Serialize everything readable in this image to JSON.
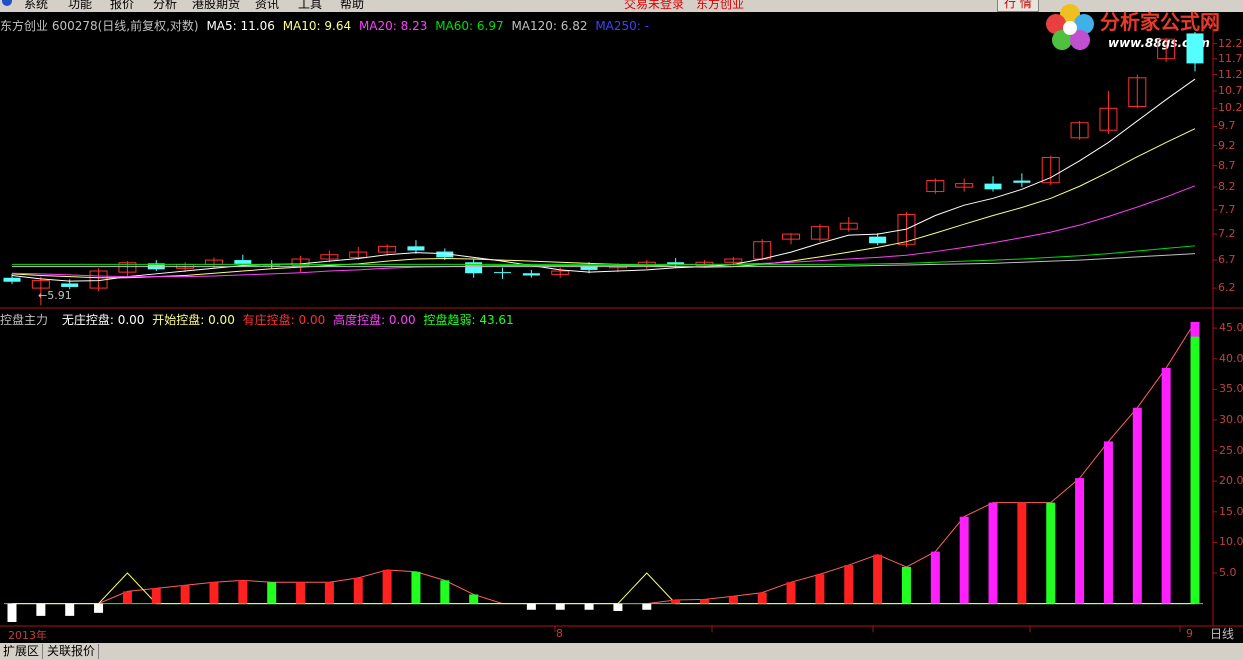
{
  "menu": {
    "items": [
      "系统",
      "功能",
      "报价",
      "分析",
      "港股期货",
      "资讯",
      "工具",
      "帮助"
    ],
    "login_status": "交易未登录",
    "stock_short": "东方创业",
    "hq_button": "行 情"
  },
  "watermark": {
    "text": "分析家公式网",
    "url": "www.88gs.com"
  },
  "stock_title": {
    "name": "东方创业 600278(日线,前复权,对数)",
    "ma5": "MA5: 11.06",
    "ma10": "MA10: 9.64",
    "ma20": "MA20: 8.23",
    "ma60": "MA60: 6.97",
    "ma120": "MA120: 6.82",
    "ma250": "MA250: -"
  },
  "low_marker": "←5.91",
  "indicator_title": {
    "name": "控盘主力",
    "f1": "无庄控盘: 0.00",
    "f2": "开始控盘: 0.00",
    "f3": "有庄控盘: 0.00",
    "f4": "高度控盘: 0.00",
    "f5": "控盘趋弱: 43.61"
  },
  "x_axis": {
    "labels": [
      "2013年",
      "8",
      "9"
    ]
  },
  "day_tab": "日线",
  "bottom_tabs": [
    "扩展区",
    "关联报价"
  ],
  "colors": {
    "up": "#ff3232",
    "down": "#54ffff",
    "ma5": "#ffffff",
    "ma10": "#ffff80",
    "ma20": "#ff40ff",
    "ma60": "#00e000",
    "ma120": "#c0c0c0",
    "ma250": "#4040ff",
    "axis": "#b01010",
    "ind_red": "#ff2020",
    "ind_magenta": "#ff20ff",
    "ind_green": "#20ff20",
    "ind_white": "#ffffff",
    "ind_yellow": "#ffff60"
  },
  "chart_data": [
    {
      "type": "candlestick",
      "title": "东方创业 600278(日线,前复权,对数)",
      "log_scale": true,
      "ylim": [
        5.9,
        12.6
      ],
      "y_ticks": [
        6.2,
        6.7,
        7.2,
        7.7,
        8.2,
        8.7,
        9.2,
        9.7,
        10.2,
        10.7,
        11.2,
        11.7,
        12.2
      ],
      "x_labels": [
        "2013年",
        "8",
        "9"
      ],
      "candles": [
        {
          "o": 6.38,
          "h": 6.45,
          "l": 6.27,
          "c": 6.31
        },
        {
          "o": 6.2,
          "h": 6.4,
          "l": 5.91,
          "c": 6.33
        },
        {
          "o": 6.28,
          "h": 6.35,
          "l": 6.18,
          "c": 6.22
        },
        {
          "o": 6.2,
          "h": 6.55,
          "l": 6.15,
          "c": 6.5
        },
        {
          "o": 6.48,
          "h": 6.68,
          "l": 6.4,
          "c": 6.65
        },
        {
          "o": 6.64,
          "h": 6.7,
          "l": 6.5,
          "c": 6.53
        },
        {
          "o": 6.55,
          "h": 6.66,
          "l": 6.48,
          "c": 6.62
        },
        {
          "o": 6.62,
          "h": 6.75,
          "l": 6.55,
          "c": 6.7
        },
        {
          "o": 6.7,
          "h": 6.8,
          "l": 6.58,
          "c": 6.63
        },
        {
          "o": 6.63,
          "h": 6.7,
          "l": 6.55,
          "c": 6.6
        },
        {
          "o": 6.6,
          "h": 6.78,
          "l": 6.48,
          "c": 6.72
        },
        {
          "o": 6.72,
          "h": 6.88,
          "l": 6.66,
          "c": 6.8
        },
        {
          "o": 6.75,
          "h": 6.95,
          "l": 6.7,
          "c": 6.85
        },
        {
          "o": 6.85,
          "h": 7.0,
          "l": 6.78,
          "c": 6.96
        },
        {
          "o": 6.96,
          "h": 7.08,
          "l": 6.82,
          "c": 6.88
        },
        {
          "o": 6.86,
          "h": 6.92,
          "l": 6.7,
          "c": 6.75
        },
        {
          "o": 6.66,
          "h": 6.72,
          "l": 6.38,
          "c": 6.46
        },
        {
          "o": 6.48,
          "h": 6.56,
          "l": 6.36,
          "c": 6.47
        },
        {
          "o": 6.46,
          "h": 6.52,
          "l": 6.38,
          "c": 6.42
        },
        {
          "o": 6.44,
          "h": 6.56,
          "l": 6.38,
          "c": 6.5
        },
        {
          "o": 6.6,
          "h": 6.66,
          "l": 6.46,
          "c": 6.52
        },
        {
          "o": 6.56,
          "h": 6.64,
          "l": 6.48,
          "c": 6.6
        },
        {
          "o": 6.6,
          "h": 6.7,
          "l": 6.54,
          "c": 6.66
        },
        {
          "o": 6.66,
          "h": 6.74,
          "l": 6.56,
          "c": 6.62
        },
        {
          "o": 6.6,
          "h": 6.7,
          "l": 6.56,
          "c": 6.66
        },
        {
          "o": 6.66,
          "h": 6.76,
          "l": 6.6,
          "c": 6.72
        },
        {
          "o": 6.72,
          "h": 7.1,
          "l": 6.7,
          "c": 7.05
        },
        {
          "o": 7.1,
          "h": 7.22,
          "l": 7.0,
          "c": 7.2
        },
        {
          "o": 7.1,
          "h": 7.4,
          "l": 7.05,
          "c": 7.35
        },
        {
          "o": 7.3,
          "h": 7.55,
          "l": 7.25,
          "c": 7.42
        },
        {
          "o": 7.15,
          "h": 7.22,
          "l": 6.98,
          "c": 7.02
        },
        {
          "o": 7.0,
          "h": 7.65,
          "l": 6.95,
          "c": 7.6
        },
        {
          "o": 8.1,
          "h": 8.4,
          "l": 8.05,
          "c": 8.35
        },
        {
          "o": 8.2,
          "h": 8.4,
          "l": 8.1,
          "c": 8.28
        },
        {
          "o": 8.28,
          "h": 8.45,
          "l": 8.1,
          "c": 8.15
        },
        {
          "o": 8.35,
          "h": 8.52,
          "l": 8.2,
          "c": 8.3
        },
        {
          "o": 8.3,
          "h": 8.95,
          "l": 8.25,
          "c": 8.9
        },
        {
          "o": 9.4,
          "h": 9.85,
          "l": 9.35,
          "c": 9.8
        },
        {
          "o": 9.6,
          "h": 10.7,
          "l": 9.5,
          "c": 10.2
        },
        {
          "o": 10.25,
          "h": 11.2,
          "l": 10.2,
          "c": 11.1
        },
        {
          "o": 11.7,
          "h": 12.4,
          "l": 11.6,
          "c": 12.35
        },
        {
          "o": 12.55,
          "h": 12.6,
          "l": 11.3,
          "c": 11.55
        }
      ],
      "series": [
        {
          "name": "MA5",
          "values": [
            6.42,
            6.36,
            6.32,
            6.33,
            6.4,
            6.45,
            6.5,
            6.55,
            6.6,
            6.62,
            6.63,
            6.68,
            6.73,
            6.8,
            6.84,
            6.82,
            6.75,
            6.68,
            6.6,
            6.52,
            6.48,
            6.5,
            6.52,
            6.56,
            6.58,
            6.62,
            6.72,
            6.85,
            7.02,
            7.18,
            7.2,
            7.3,
            7.58,
            7.8,
            7.95,
            8.15,
            8.42,
            8.82,
            9.28,
            9.85,
            10.45,
            11.06
          ]
        },
        {
          "name": "MA10",
          "values": [
            6.45,
            6.42,
            6.4,
            6.38,
            6.38,
            6.4,
            6.42,
            6.46,
            6.5,
            6.54,
            6.57,
            6.6,
            6.63,
            6.68,
            6.72,
            6.73,
            6.72,
            6.7,
            6.68,
            6.66,
            6.64,
            6.62,
            6.6,
            6.58,
            6.57,
            6.58,
            6.62,
            6.68,
            6.76,
            6.85,
            6.94,
            7.05,
            7.22,
            7.4,
            7.58,
            7.75,
            7.95,
            8.22,
            8.55,
            8.92,
            9.28,
            9.64
          ]
        },
        {
          "name": "MA20",
          "values": [
            6.46,
            6.45,
            6.43,
            6.41,
            6.4,
            6.4,
            6.4,
            6.41,
            6.43,
            6.45,
            6.47,
            6.5,
            6.52,
            6.55,
            6.57,
            6.58,
            6.59,
            6.6,
            6.6,
            6.6,
            6.6,
            6.6,
            6.6,
            6.61,
            6.62,
            6.62,
            6.64,
            6.66,
            6.69,
            6.72,
            6.75,
            6.79,
            6.86,
            6.94,
            7.03,
            7.13,
            7.24,
            7.38,
            7.56,
            7.76,
            7.98,
            8.23
          ]
        },
        {
          "name": "MA60",
          "values": [
            6.62,
            6.62,
            6.62,
            6.62,
            6.62,
            6.62,
            6.62,
            6.62,
            6.62,
            6.62,
            6.62,
            6.62,
            6.62,
            6.62,
            6.62,
            6.62,
            6.62,
            6.62,
            6.62,
            6.62,
            6.62,
            6.62,
            6.62,
            6.62,
            6.62,
            6.62,
            6.62,
            6.62,
            6.62,
            6.62,
            6.63,
            6.64,
            6.66,
            6.68,
            6.7,
            6.72,
            6.75,
            6.78,
            6.82,
            6.87,
            6.92,
            6.97
          ]
        },
        {
          "name": "MA120",
          "values": [
            6.58,
            6.58,
            6.58,
            6.58,
            6.58,
            6.58,
            6.58,
            6.58,
            6.58,
            6.58,
            6.58,
            6.58,
            6.58,
            6.58,
            6.58,
            6.58,
            6.58,
            6.58,
            6.58,
            6.58,
            6.58,
            6.58,
            6.58,
            6.58,
            6.58,
            6.58,
            6.58,
            6.58,
            6.58,
            6.59,
            6.6,
            6.61,
            6.62,
            6.63,
            6.64,
            6.66,
            6.68,
            6.7,
            6.73,
            6.76,
            6.79,
            6.82
          ]
        }
      ]
    },
    {
      "type": "bar",
      "title": "控盘主力",
      "ylim": [
        -3,
        46
      ],
      "y_ticks": [
        5,
        10,
        15,
        20,
        25,
        30,
        35,
        40,
        45
      ],
      "series": [
        {
          "name": "无庄控盘",
          "values": [
            -3,
            -2,
            -2,
            -1.5,
            0,
            0,
            0,
            0,
            0,
            0,
            0,
            0,
            0,
            0,
            0,
            0,
            0,
            0,
            -1,
            -1,
            -1,
            -1.2,
            -1,
            0,
            0,
            0,
            0,
            0,
            0,
            0,
            0,
            0,
            0,
            0,
            0,
            0,
            0,
            0,
            0,
            0,
            0,
            0
          ]
        },
        {
          "name": "开始控盘",
          "values": [
            0,
            0,
            0,
            0,
            5,
            0,
            0,
            0,
            0,
            0,
            0,
            0,
            0,
            0,
            0,
            0,
            0,
            0,
            0,
            0,
            0,
            0,
            5,
            0,
            0,
            0,
            0,
            0,
            0,
            0,
            0,
            0,
            0,
            0,
            0,
            0,
            0,
            0,
            0,
            0,
            0,
            0
          ]
        },
        {
          "name": "有庄控盘",
          "values": [
            0,
            0,
            0,
            0,
            2,
            2.5,
            3,
            3.5,
            3.8,
            0,
            3.5,
            3.5,
            4.2,
            5.5,
            0,
            0,
            0,
            0,
            0,
            0,
            0,
            0,
            0,
            0.6,
            0.7,
            1.2,
            1.8,
            3.5,
            4.8,
            6.3,
            8,
            0,
            0,
            0,
            0,
            16.5,
            0,
            0,
            0,
            0,
            0,
            0
          ]
        },
        {
          "name": "高度控盘",
          "values": [
            0,
            0,
            0,
            0,
            0,
            0,
            0,
            0,
            0,
            0,
            0,
            0,
            0,
            0,
            0,
            0,
            0,
            0,
            0,
            0,
            0,
            0,
            0,
            0,
            0,
            0,
            0,
            0,
            0,
            0,
            0,
            0,
            8.5,
            14.2,
            16.5,
            0,
            0,
            20.5,
            26.5,
            32,
            38.5,
            46
          ]
        },
        {
          "name": "控盘趋弱",
          "values": [
            0,
            0,
            0,
            0,
            0,
            0,
            0,
            0,
            0,
            3.5,
            0,
            0,
            0,
            0,
            5.2,
            3.8,
            1.5,
            0,
            0,
            0,
            0,
            0,
            0,
            0,
            0,
            0,
            0,
            0,
            0,
            0,
            0,
            6,
            0,
            0,
            0,
            0,
            16.5,
            0,
            0,
            0,
            0,
            43.61
          ]
        }
      ]
    }
  ]
}
